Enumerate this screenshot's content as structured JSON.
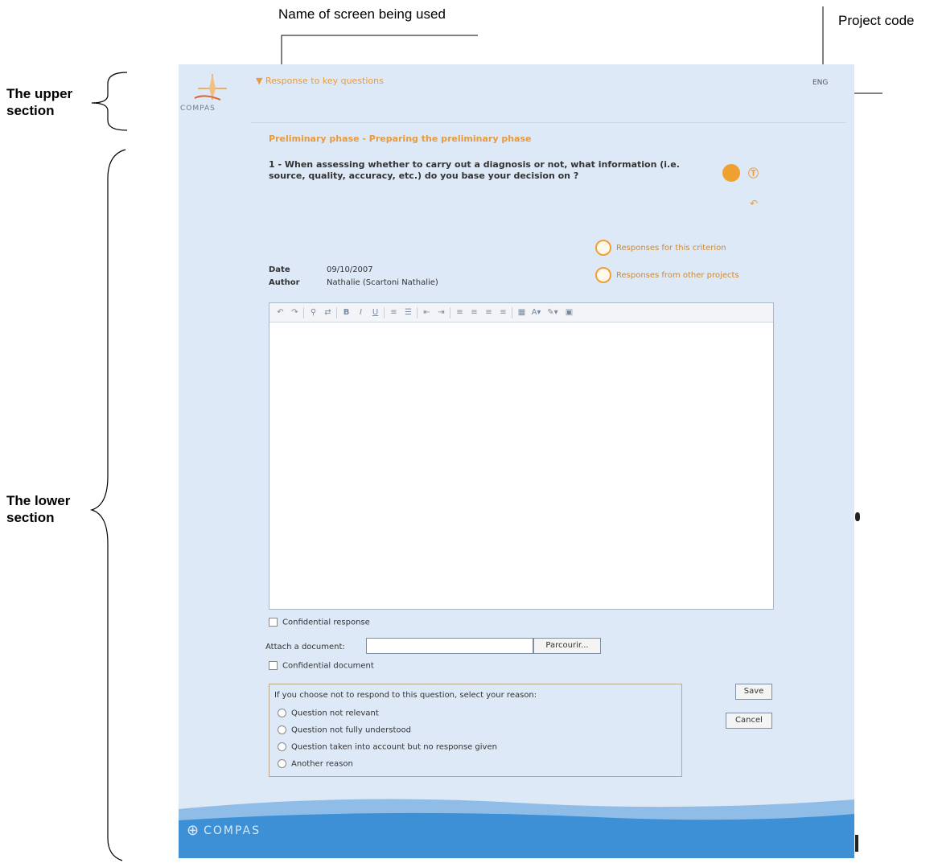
{
  "annotations": {
    "screen_name": "Name of screen being used",
    "project_code": "Project code",
    "upper_section": "The upper\nsection",
    "lower_section": "The lower\nsection"
  },
  "app": {
    "logo_text": "COMPAS",
    "breadcrumb": "Response to key questions",
    "language": "ENG",
    "phase_title": "Preliminary phase - Preparing the preliminary phase",
    "question": "1 - When assessing whether to carry out a diagnosis or not, what information (i.e. source, quality, accuracy, etc.) do you base your decision on ?",
    "date_label": "Date",
    "date_value": "09/10/2007",
    "author_label": "Author",
    "author_value": "Nathalie (Scartoni Nathalie)",
    "responses_criterion": "Responses for this criterion",
    "responses_other": "Responses from other projects",
    "confidential_response": "Confidential response",
    "attach_label": "Attach a document:",
    "browse_button": "Parcourir...",
    "confidential_document": "Confidential document",
    "reason_prompt": "If you choose not to respond to this question, select your reason:",
    "reasons": [
      "Question not relevant",
      "Question not fully understood",
      "Question taken into account but no response given",
      "Another reason"
    ],
    "save_button": "Save",
    "cancel_button": "Cancel",
    "footer_logo": "COMPAS"
  },
  "colors": {
    "accent": "#e89a3c",
    "background": "#dde9f6",
    "footer": "#3d8fd6"
  }
}
